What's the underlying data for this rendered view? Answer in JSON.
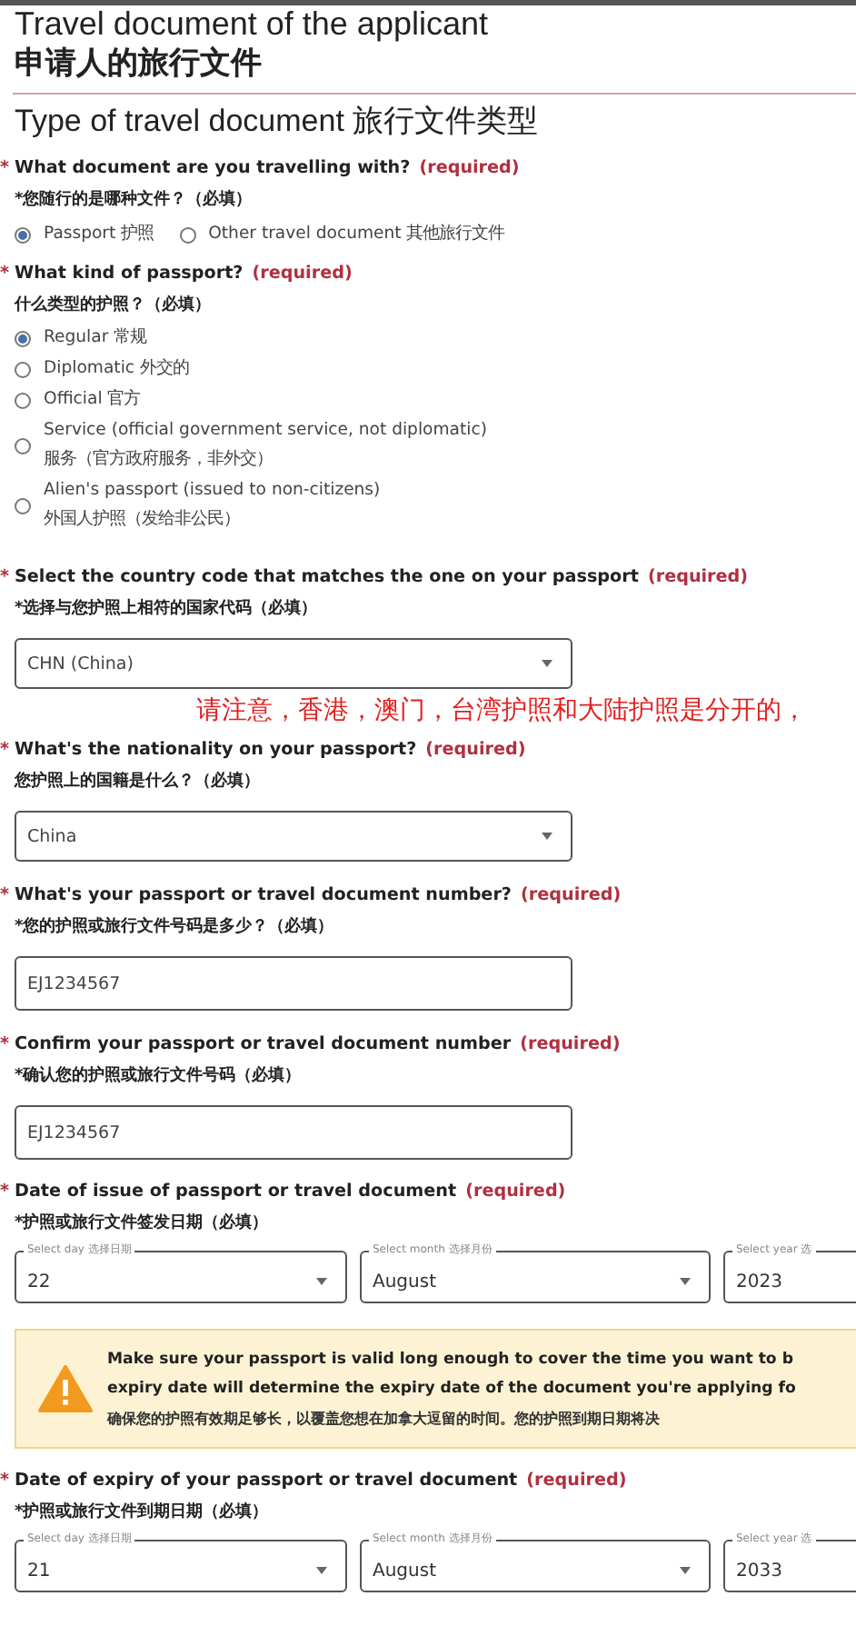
{
  "page": {
    "title": "Travel document of the applicant",
    "title_zh": "申请人的旅行文件"
  },
  "section": {
    "heading": "Type of travel document 旅行文件类型"
  },
  "questions": [
    {
      "kind": "radio_inline",
      "marker": "*",
      "label": "What document are you travelling with?",
      "required": "(required)",
      "label_zh": "*您随行的是哪种文件？（必填）",
      "options": [
        {
          "label": "Passport 护照",
          "selected": true
        },
        {
          "label": "Other travel document 其他旅行文件",
          "selected": false
        }
      ]
    },
    {
      "kind": "radio_list",
      "marker": "*",
      "label": "What kind of passport?",
      "required": "(required)",
      "label_zh": "什么类型的护照？（必填）",
      "options": [
        {
          "label": "Regular 常规",
          "selected": true
        },
        {
          "label": "Diplomatic 外交的",
          "selected": false
        },
        {
          "label": "Official 官方",
          "selected": false
        },
        {
          "label": "Service (official government service, not diplomatic)",
          "label_zh": "服务（官方政府服务，非外交）",
          "selected": false
        },
        {
          "label": "Alien's passport (issued to non-citizens)",
          "label_zh": "外国人护照（发给非公民）",
          "selected": false
        }
      ]
    },
    {
      "kind": "select",
      "marker": "*",
      "label": "Select the country code that matches the one on your passport",
      "required": "(required)",
      "label_zh": "*选择与您护照上相符的国家代码（必填）",
      "value": "CHN (China)",
      "annotation": "请注意，香港，澳门，台湾护照和大陆护照是分开的，"
    },
    {
      "kind": "select",
      "marker": "*",
      "label": "What's the nationality on your passport?",
      "required": "(required)",
      "label_zh": "您护照上的国籍是什么？（必填）",
      "value": "China"
    },
    {
      "kind": "text",
      "marker": "*",
      "label": "What's your passport or travel document number?",
      "required": "(required)",
      "label_zh": "*您的护照或旅行文件号码是多少？（必填）",
      "value": "EJ1234567"
    },
    {
      "kind": "text",
      "marker": "*",
      "label": "Confirm your passport or travel document number",
      "required": "(required)",
      "label_zh": "*确认您的护照或旅行文件号码（必填）",
      "value": "EJ1234567"
    },
    {
      "kind": "date",
      "marker": "*",
      "label": "Date of issue of passport or travel document",
      "required": "(required)",
      "label_zh": "*护照或旅行文件签发日期（必填）",
      "parts": [
        {
          "label": "Select day 选择日期",
          "value": "22"
        },
        {
          "label": "Select month 选择月份",
          "value": "August"
        },
        {
          "label": "Select year 选",
          "value": "2023"
        }
      ]
    },
    {
      "kind": "warning",
      "lines": [
        "Make sure your passport is valid long enough to cover the time you want to b",
        "expiry date will determine the expiry date of the document you're applying fo"
      ],
      "line_zh": "确保您的护照有效期足够长，以覆盖您想在加拿大逗留的时间。您的护照到期日期将决"
    },
    {
      "kind": "date",
      "marker": "*",
      "label": "Date of expiry of your passport or travel document",
      "required": "(required)",
      "label_zh": "*护照或旅行文件到期日期（必填）",
      "parts": [
        {
          "label": "Select day 选择日期",
          "value": "21"
        },
        {
          "label": "Select month 选择月份",
          "value": "August"
        },
        {
          "label": "Select year 选",
          "value": "2033"
        }
      ]
    }
  ]
}
